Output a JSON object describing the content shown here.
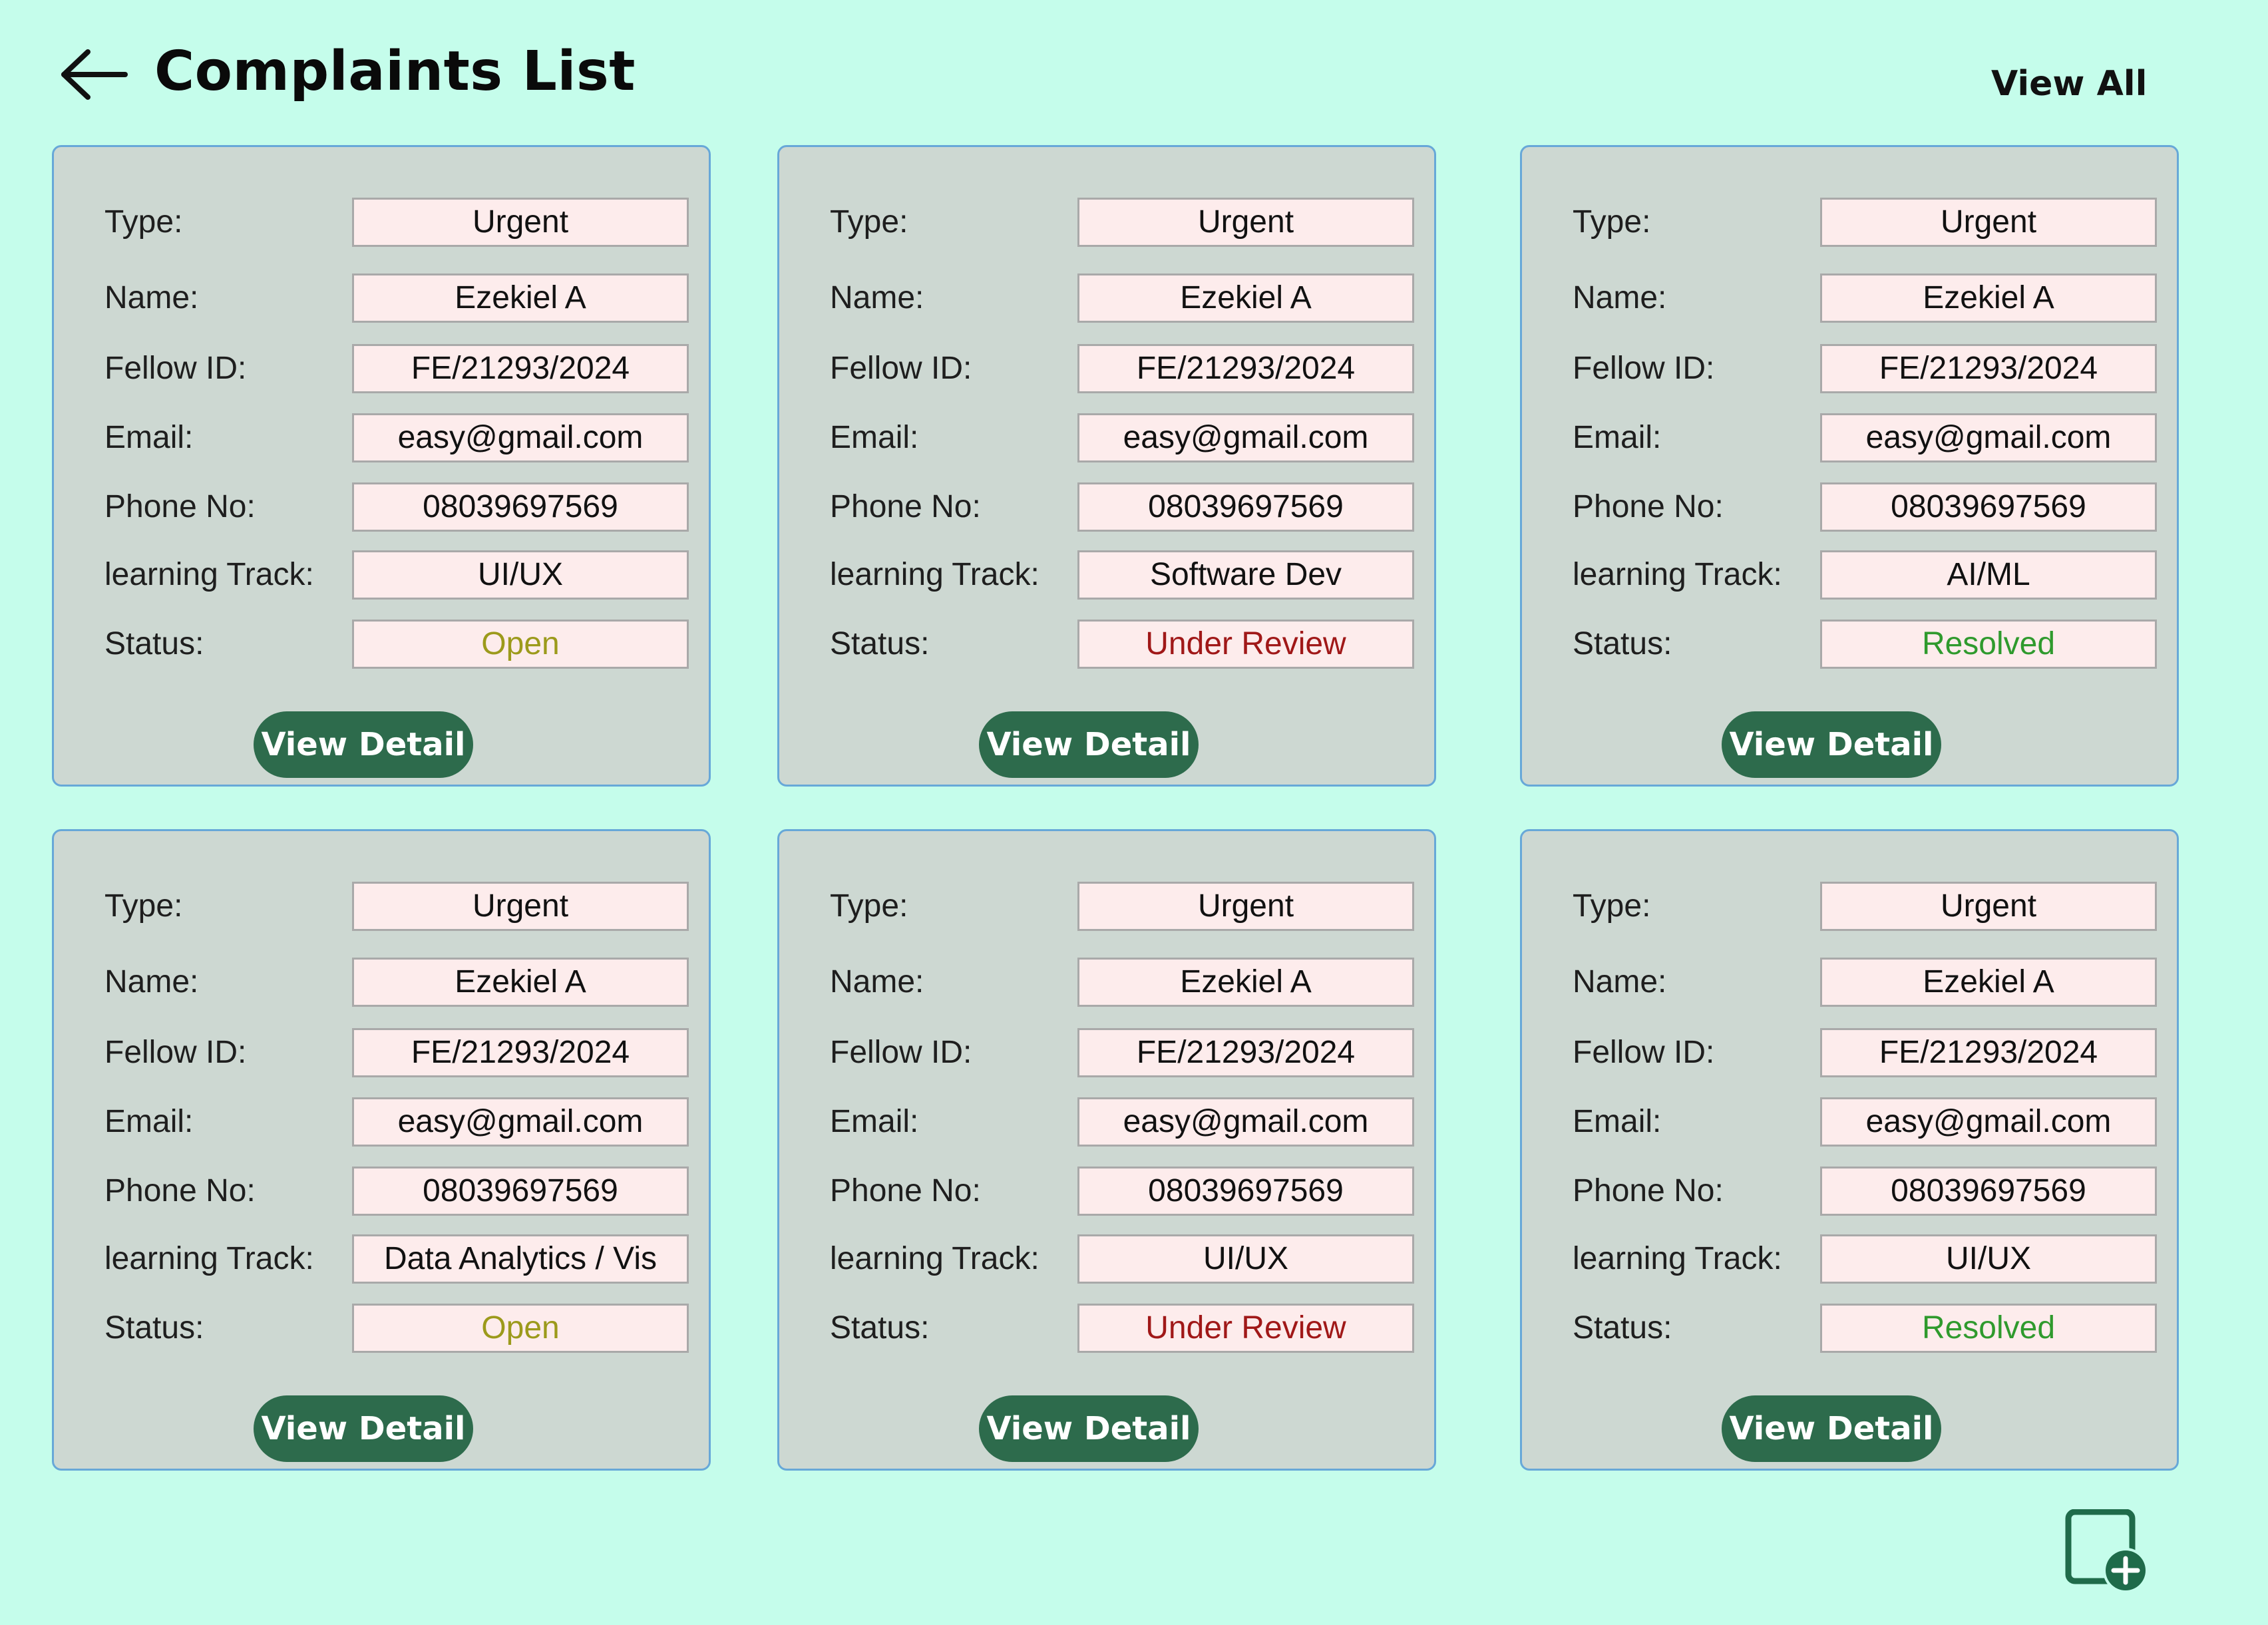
{
  "header": {
    "title": "Complaints List",
    "view_all_label": "View All",
    "back_icon": "arrow-left-icon"
  },
  "labels": {
    "type": "Type:",
    "name": "Name:",
    "fellow_id": "Fellow ID:",
    "email": "Email:",
    "phone": "Phone No:",
    "track": "learning Track:",
    "status": "Status:"
  },
  "cards": [
    {
      "type": "Urgent",
      "name": "Ezekiel A",
      "fellow_id": "FE/21293/2024",
      "email": "easy@gmail.com",
      "phone": "08039697569",
      "track": "UI/UX",
      "status": "Open",
      "button": "View Detail"
    },
    {
      "type": "Urgent",
      "name": "Ezekiel A",
      "fellow_id": "FE/21293/2024",
      "email": "easy@gmail.com",
      "phone": "08039697569",
      "track": "Software Dev",
      "status": "Under Review",
      "button": "View Detail"
    },
    {
      "type": "Urgent",
      "name": "Ezekiel A",
      "fellow_id": "FE/21293/2024",
      "email": "easy@gmail.com",
      "phone": "08039697569",
      "track": "AI/ML",
      "status": "Resolved",
      "button": "View Detail"
    },
    {
      "type": "Urgent",
      "name": "Ezekiel A",
      "fellow_id": "FE/21293/2024",
      "email": "easy@gmail.com",
      "phone": "08039697569",
      "track": "Data Analytics / Vis",
      "status": "Open",
      "button": "View Detail"
    },
    {
      "type": "Urgent",
      "name": "Ezekiel A",
      "fellow_id": "FE/21293/2024",
      "email": "easy@gmail.com",
      "phone": "08039697569",
      "track": "UI/UX",
      "status": "Under Review",
      "button": "View Detail"
    },
    {
      "type": "Urgent",
      "name": "Ezekiel A",
      "fellow_id": "FE/21293/2024",
      "email": "easy@gmail.com",
      "phone": "08039697569",
      "track": "UI/UX",
      "status": "Resolved",
      "button": "View Detail"
    }
  ],
  "status_colors": {
    "Open": "#9c9a1b",
    "Under Review": "#a01818",
    "Resolved": "#2f9a2d"
  },
  "colors": {
    "background": "#c5fdeb",
    "card": "#cdd8d2",
    "button": "#2d6b4c",
    "field": "#fdecec"
  },
  "fab": {
    "icon": "add-document-icon"
  }
}
